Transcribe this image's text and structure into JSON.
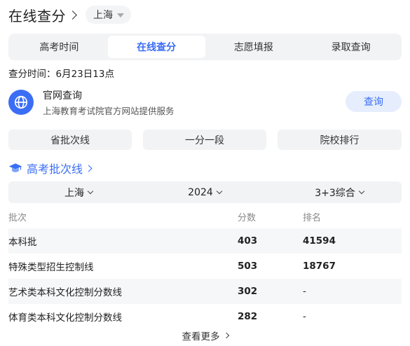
{
  "header": {
    "title": "在线查分",
    "region": "上海"
  },
  "tabs": [
    {
      "label": "高考时间",
      "active": false
    },
    {
      "label": "在线查分",
      "active": true
    },
    {
      "label": "志愿填报",
      "active": false
    },
    {
      "label": "录取查询",
      "active": false
    }
  ],
  "query_time": "查分时间：6月23日13点",
  "official": {
    "title": "官网查询",
    "subtitle": "上海教育考试院官方网站提供服务",
    "button": "查询",
    "icon": "globe-icon"
  },
  "quick_links": [
    "省批次线",
    "一分一段",
    "院校排行"
  ],
  "section": {
    "title": "高考批次线",
    "icon": "graduation-cap-icon"
  },
  "filters": {
    "region": "上海",
    "year": "2024",
    "subject": "3+3综合"
  },
  "table": {
    "headers": [
      "批次",
      "分数",
      "排名"
    ],
    "rows": [
      {
        "batch": "本科批",
        "score": "403",
        "rank": "41594"
      },
      {
        "batch": "特殊类型招生控制线",
        "score": "503",
        "rank": "18767"
      },
      {
        "batch": "艺术类本科文化控制分数线",
        "score": "302",
        "rank": "-"
      },
      {
        "batch": "体育类本科文化控制分数线",
        "score": "282",
        "rank": "-"
      }
    ]
  },
  "more_label": "查看更多",
  "colors": {
    "accent": "#3b6ef5",
    "panel": "#f2f3f5",
    "button_bg": "#e6eefd"
  }
}
